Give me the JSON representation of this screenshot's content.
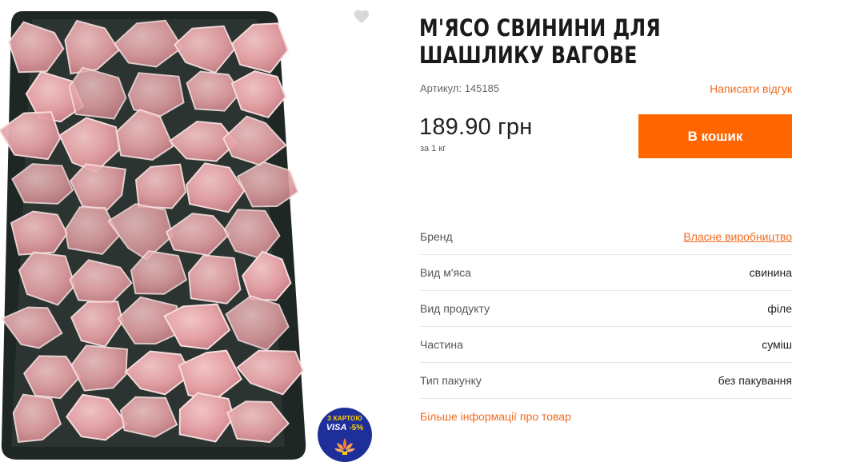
{
  "product": {
    "title": "М'ЯСО СВИНИНИ ДЛЯ ШАШЛИКУ ВАГОВЕ",
    "sku_label": "Артикул: 145185",
    "review_link": "Написати відгук",
    "price": "189.90 грн",
    "price_unit": "за 1 кг",
    "cart_button": "В кошик",
    "favorite_icon": "heart-icon",
    "image_icon": "product-photo"
  },
  "promo_badge": {
    "line1": "З КАРТОЮ",
    "brand": "VISA",
    "discount": "-5%"
  },
  "specs": [
    {
      "key": "Бренд",
      "value": "Власне виробництво",
      "link": true
    },
    {
      "key": "Вид м'яса",
      "value": "свинина",
      "link": false
    },
    {
      "key": "Вид продукту",
      "value": "філе",
      "link": false
    },
    {
      "key": "Частина",
      "value": "суміш",
      "link": false
    },
    {
      "key": "Тип пакунку",
      "value": "без пакування",
      "link": false
    }
  ],
  "more_info_link": "Більше інформації про товар",
  "colors": {
    "accent": "#ff6600",
    "link": "#ef6b23",
    "tray": "#1f2724",
    "meat": "#e8a9ac",
    "badge": "#1f2f9a"
  }
}
